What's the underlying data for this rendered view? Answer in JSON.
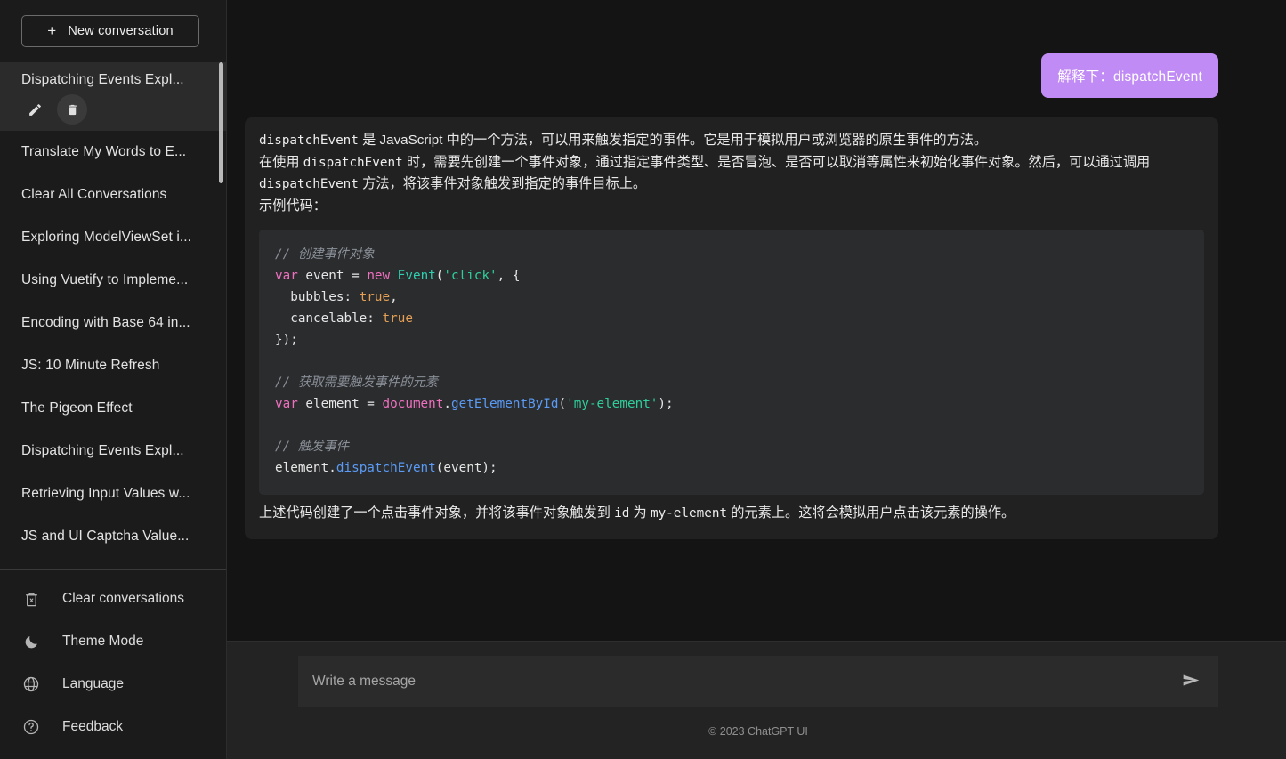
{
  "sidebar": {
    "new_conversation_label": "New conversation",
    "plus_glyph": "+",
    "conversations": [
      {
        "title": "Dispatching Events Expl...",
        "active": true
      },
      {
        "title": "Translate My Words to E...",
        "active": false
      },
      {
        "title": "Clear All Conversations",
        "active": false
      },
      {
        "title": "Exploring ModelViewSet i...",
        "active": false
      },
      {
        "title": "Using Vuetify to Impleme...",
        "active": false
      },
      {
        "title": "Encoding with Base 64 in...",
        "active": false
      },
      {
        "title": "JS: 10 Minute Refresh",
        "active": false
      },
      {
        "title": "The Pigeon Effect",
        "active": false
      },
      {
        "title": "Dispatching Events Expl...",
        "active": false
      },
      {
        "title": "Retrieving Input Values w...",
        "active": false
      },
      {
        "title": "JS and UI Captcha Value...",
        "active": false
      }
    ],
    "active_item_actions": {
      "edit_icon": "pencil-icon",
      "delete_icon": "trash-icon"
    },
    "footer_items": [
      {
        "label": "Clear conversations",
        "icon": "trash-x-icon"
      },
      {
        "label": "Theme Mode",
        "icon": "moon-icon"
      },
      {
        "label": "Language",
        "icon": "globe-icon"
      },
      {
        "label": "Feedback",
        "icon": "question-circle-icon"
      }
    ]
  },
  "chat": {
    "user_message": "解释下：dispatchEvent",
    "assistant": {
      "para1_a": "dispatchEvent",
      "para1_b": " 是 JavaScript 中的一个方法，可以用来触发指定的事件。它是用于模拟用户或浏览器的原生事件的方法。",
      "para2_a": "在使用 ",
      "para2_code": "dispatchEvent",
      "para2_b": " 时，需要先创建一个事件对象，通过指定事件类型、是否冒泡、是否可以取消等属性来初始化事件对象。然后，可以通过调用 ",
      "para2_code2": "dispatchEvent",
      "para2_c": " 方法，将该事件对象触发到指定的事件目标上。",
      "para3": "示例代码：",
      "code": {
        "comment1": "// 创建事件对象",
        "line2_kw1": "var",
        "line2_name": " event ",
        "line2_eq": "= ",
        "line2_kw2": "new",
        "line2_cls": " Event",
        "line2_open": "(",
        "line2_str": "'click'",
        "line2_rest": ", {",
        "line3_key": "  bubbles: ",
        "line3_val": "true",
        "line3_comma": ",",
        "line4_key": "  cancelable: ",
        "line4_val": "true",
        "line5": "});",
        "comment2": "// 获取需要触发事件的元素",
        "line7_kw": "var",
        "line7_name": " element ",
        "line7_eq": "= ",
        "line7_obj": "document",
        "line7_dot": ".",
        "line7_fn": "getElementById",
        "line7_open": "(",
        "line7_str": "'my-element'",
        "line7_close": ");",
        "comment3": "// 触发事件",
        "line9_name": "element",
        "line9_dot": ".",
        "line9_fn": "dispatchEvent",
        "line9_rest": "(event);"
      },
      "para4_a": "上述代码创建了一个点击事件对象，并将该事件对象触发到 ",
      "para4_code1": "id",
      "para4_b": " 为 ",
      "para4_code2": "my-element",
      "para4_c": " 的元素上。这将会模拟用户点击该元素的操作。"
    }
  },
  "composer": {
    "placeholder": "Write a message",
    "value": "",
    "send_icon": "send-arrow-icon"
  },
  "footer": {
    "copyright": "© 2023 ChatGPT UI"
  },
  "colors": {
    "user_bubble": "#c18bf5",
    "bot_bubble": "#212121",
    "code_block": "#2b2c2e",
    "page_bg": "#141414",
    "sidebar_bg": "#1b1b1b"
  }
}
